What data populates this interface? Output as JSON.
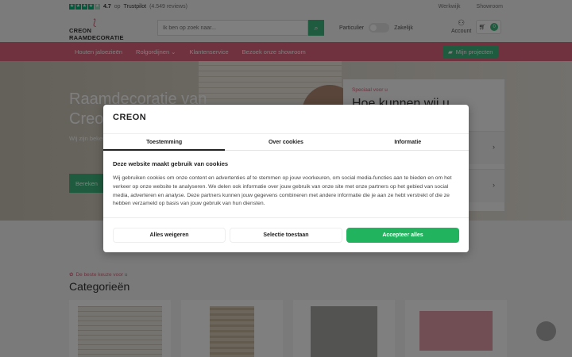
{
  "topbar": {
    "rating": "4.7",
    "rating_conj": "op",
    "trustpilot": "Trustpilot",
    "reviews": "(4.549 reviews)",
    "links": [
      "Werkwijk",
      "Showroom"
    ]
  },
  "header": {
    "logo_text": "CREON RAAMDECORATIE",
    "search_placeholder": "Ik ben op zoek naar...",
    "toggle_left": "Particulier",
    "toggle_right": "Zakelijk",
    "account": "Account",
    "cart_count": "0"
  },
  "nav": {
    "items": [
      "Houten jaloezieën",
      "Rolgordijnen",
      "Klantenservice",
      "Bezoek onze showroom"
    ],
    "projects": "Mijn projecten"
  },
  "hero": {
    "title": "Raamdecoratie van Creon",
    "text": "Wij zijn bekend op kwaliteit 30 seconden",
    "button": "Bereken"
  },
  "special": {
    "label": "Speciaal voor u",
    "title": "Hoe kunnen wij u"
  },
  "categories": {
    "tag": "De beste keuze voor u",
    "title": "Categorieën"
  },
  "modal": {
    "logo": "CREON",
    "tabs": [
      "Toestemming",
      "Over cookies",
      "Informatie"
    ],
    "heading": "Deze website maakt gebruik van cookies",
    "body": "Wij gebruiken cookies om onze content en advertenties af te stemmen op jouw voorkeuren, om social media-functies aan te bieden en om het verkeer op onze website te analyseren. We delen ook informatie over jouw gebruik van onze site met onze partners op het gebied van social media, adverteren en analyse. Deze partners kunnen jouw gegevens combineren met andere informatie die je aan ze hebt verstrekt of die ze hebben verzameld op basis van jouw gebruik van hun diensten.",
    "buttons": {
      "deny": "Alles weigeren",
      "select": "Selectie toestaan",
      "accept": "Accepteer alles"
    }
  },
  "colors": {
    "accent_pink": "#e0657f",
    "accent_green": "#22b35e"
  }
}
